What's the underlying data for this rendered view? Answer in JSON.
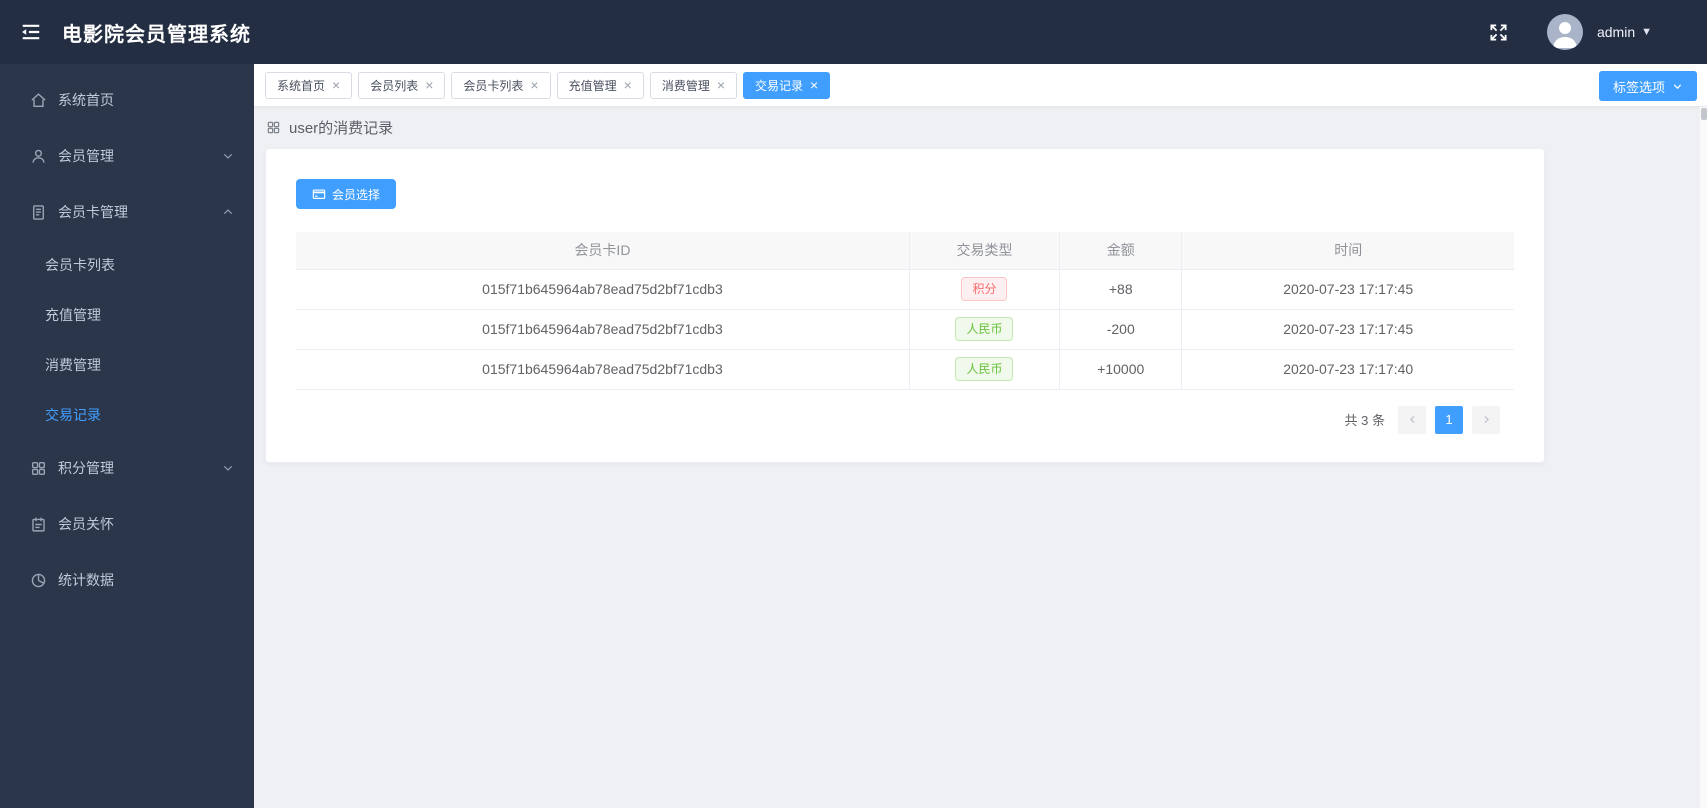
{
  "header": {
    "title": "电影院会员管理系统",
    "user": "admin"
  },
  "sidebar": {
    "items": [
      {
        "id": "home",
        "label": "系统首页",
        "icon": "home-icon"
      },
      {
        "id": "member-management",
        "label": "会员管理",
        "icon": "user-icon",
        "expandable": true,
        "expanded": false
      },
      {
        "id": "member-card-management",
        "label": "会员卡管理",
        "icon": "document-icon",
        "expandable": true,
        "expanded": true,
        "children": [
          {
            "id": "member-card-list",
            "label": "会员卡列表",
            "active": false
          },
          {
            "id": "recharge-management",
            "label": "充值管理",
            "active": false
          },
          {
            "id": "consumption-management",
            "label": "消费管理",
            "active": false
          },
          {
            "id": "transaction-records",
            "label": "交易记录",
            "active": true
          }
        ]
      },
      {
        "id": "points-management",
        "label": "积分管理",
        "icon": "grid-icon",
        "expandable": true,
        "expanded": false
      },
      {
        "id": "member-care",
        "label": "会员关怀",
        "icon": "notebook-icon"
      },
      {
        "id": "statistics",
        "label": "统计数据",
        "icon": "pie-icon"
      }
    ]
  },
  "tabs": {
    "items": [
      {
        "id": "home",
        "label": "系统首页",
        "active": false
      },
      {
        "id": "member-list",
        "label": "会员列表",
        "active": false
      },
      {
        "id": "member-card-list",
        "label": "会员卡列表",
        "active": false
      },
      {
        "id": "recharge-management",
        "label": "充值管理",
        "active": false
      },
      {
        "id": "consumption-management",
        "label": "消费管理",
        "active": false
      },
      {
        "id": "transaction-records",
        "label": "交易记录",
        "active": true
      }
    ],
    "options_button": "标签选项"
  },
  "content": {
    "heading": "user的消费记录",
    "select_button": "会员选择",
    "table": {
      "columns": [
        "会员卡ID",
        "交易类型",
        "金额",
        "时间"
      ],
      "rows": [
        {
          "card_id": "015f71b645964ab78ead75d2bf71cdb3",
          "type": "积分",
          "type_color": "red",
          "amount": "+88",
          "time": "2020-07-23 17:17:45"
        },
        {
          "card_id": "015f71b645964ab78ead75d2bf71cdb3",
          "type": "人民币",
          "type_color": "green",
          "amount": "-200",
          "time": "2020-07-23 17:17:45"
        },
        {
          "card_id": "015f71b645964ab78ead75d2bf71cdb3",
          "type": "人民币",
          "type_color": "green",
          "amount": "+10000",
          "time": "2020-07-23 17:17:40"
        }
      ]
    },
    "pagination": {
      "total_text": "共 3 条",
      "current_page": "1"
    }
  },
  "colors": {
    "accent": "#409EFF",
    "danger": "#F56C6C",
    "success": "#67C23A",
    "header_bg": "#232E43",
    "sidebar_bg": "#2B364A"
  }
}
